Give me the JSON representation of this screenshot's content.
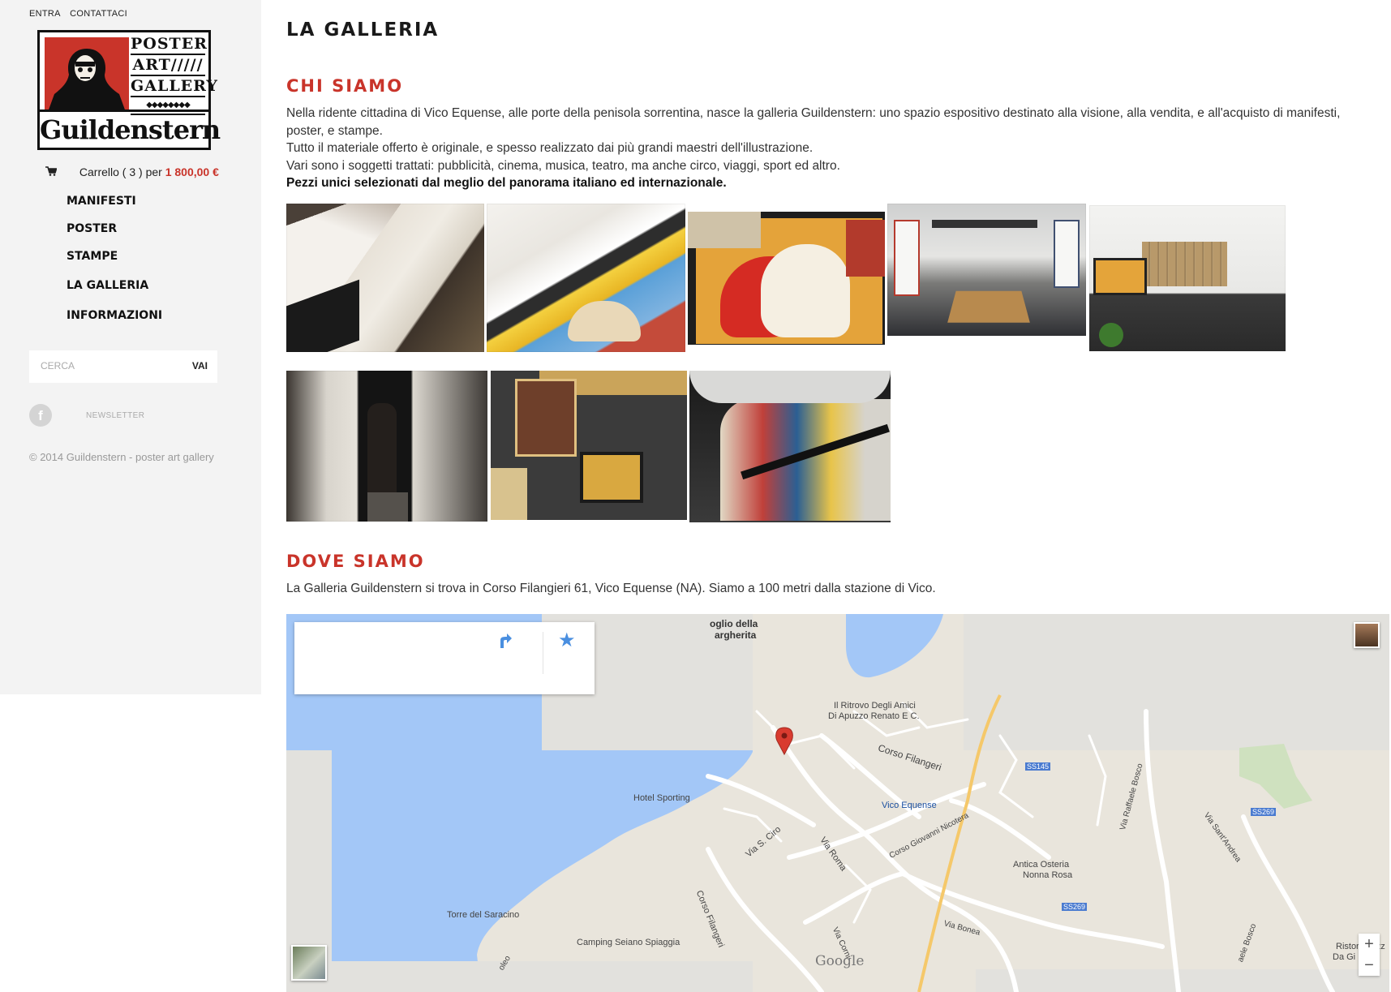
{
  "sidebar": {
    "top_links": [
      "ENTRA",
      "CONTATTACI"
    ],
    "logo": {
      "rows": [
        "POSTER",
        "ART/////",
        "GALLERY"
      ],
      "diamonds": "◆◆◆◆◆◆◆◆",
      "name": "Guildenstern"
    },
    "cart": {
      "label": "Carrello ( 3 ) per",
      "price": "1 800,00 €"
    },
    "menu": [
      "MANIFESTI",
      "POSTER",
      "STAMPE",
      "LA GALLERIA",
      "INFORMAZIONI"
    ],
    "search": {
      "placeholder": "CERCA",
      "button": "VAI"
    },
    "social": {
      "facebook": "f",
      "newsletter": "NEWSLETTER"
    },
    "copyright": "© 2014 Guildenstern - poster art gallery"
  },
  "main": {
    "title": "LA GALLERIA",
    "chi_siamo": {
      "heading": "CHI SIAMO",
      "p1": "Nella ridente cittadina di Vico Equense, alle porte della penisola sorrentina, nasce la galleria Guildenstern: uno spazio espositivo destinato alla visione, alla vendita, e all'acquisto di manifesti, poster, e stampe.",
      "p2": "Tutto il materiale offerto è originale, e spesso realizzato dai più grandi maestri dell'illustrazione.",
      "p3": "Vari sono i soggetti trattati: pubblicità, cinema, musica, teatro, ma anche circo, viaggi, sport ed altro.",
      "p4": "Pezzi unici selezionati dal meglio del panorama italiano ed internazionale."
    },
    "dove_siamo": {
      "heading": "DOVE SIAMO",
      "text": "La Galleria Guildenstern si trova in Corso Filangieri 61, Vico Equense (NA). Siamo a 100 metri dalla stazione di Vico."
    }
  },
  "map": {
    "labels": {
      "l1": "oglio della",
      "l2": "argherita",
      "l3": "Il Ritrovo Degli Amici",
      "l4": "Di Apuzzo Renato E C.",
      "l5": "Hotel Sporting",
      "l6": "Corso Filangeri",
      "l7": "Vico Equense",
      "l8": "Via S. Ciro",
      "l9": "Via Roma",
      "l10": "Corso Giovanni Nicotera",
      "l11": "Antica Osteria",
      "l12": "Nonna Rosa",
      "l13": "Torre del Saracino",
      "l14": "Camping Seiano Spiaggia",
      "l15": "Corso Filangeri",
      "l16": "Via Bonea",
      "l17": "Via Raffaele Bosco",
      "l18": "Via Sant'Andrea",
      "l19": "SS145",
      "l20": "SS269",
      "l21": "SS269",
      "l22": "Ristor",
      "l23": "Da Gi",
      "l24": "Via Corni",
      "l25": "Pizz",
      "l26": "aele Bosco",
      "l27": "oleo"
    },
    "google": "Google",
    "zoom_in": "+",
    "zoom_out": "−",
    "direction_icon": "directions-icon",
    "star_icon": "star-icon"
  }
}
